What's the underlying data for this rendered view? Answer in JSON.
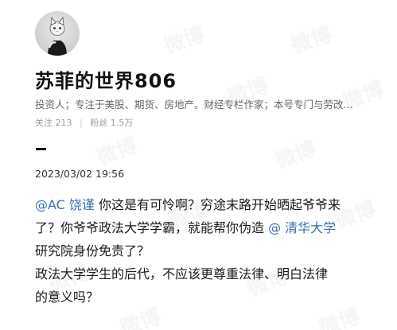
{
  "profile": {
    "name": "苏菲的世界806",
    "bio": "投资人；专注于美股、期货、房地产。财经专栏作家；本号专门与劳改...",
    "following_label": "关注",
    "following_count": "213",
    "followers_label": "粉丝",
    "followers_count": "1.5万",
    "avatar_icon": "cat-avatar-icon"
  },
  "post": {
    "timestamp": "2023/03/02 19:56",
    "line1_mention": "@AC 饶谨",
    "line1_text": " 你这是有可怜啊？穷途末路开始晒起爷爷来",
    "line2_text": "了？你爷爷政法大学学霸，就能帮你伪造 ",
    "line2_mention": "@ 清华大学",
    "line3_text": "研究院身份免责了？",
    "line4_text": "政法大学学生的后代，不应该更尊重法律、明白法律",
    "line5_text": "的意义吗？"
  },
  "watermark": {
    "text": "微博"
  },
  "colors": {
    "mention": "#3a6fb0",
    "text": "#1a1a1a",
    "muted": "#9a9a9a"
  }
}
